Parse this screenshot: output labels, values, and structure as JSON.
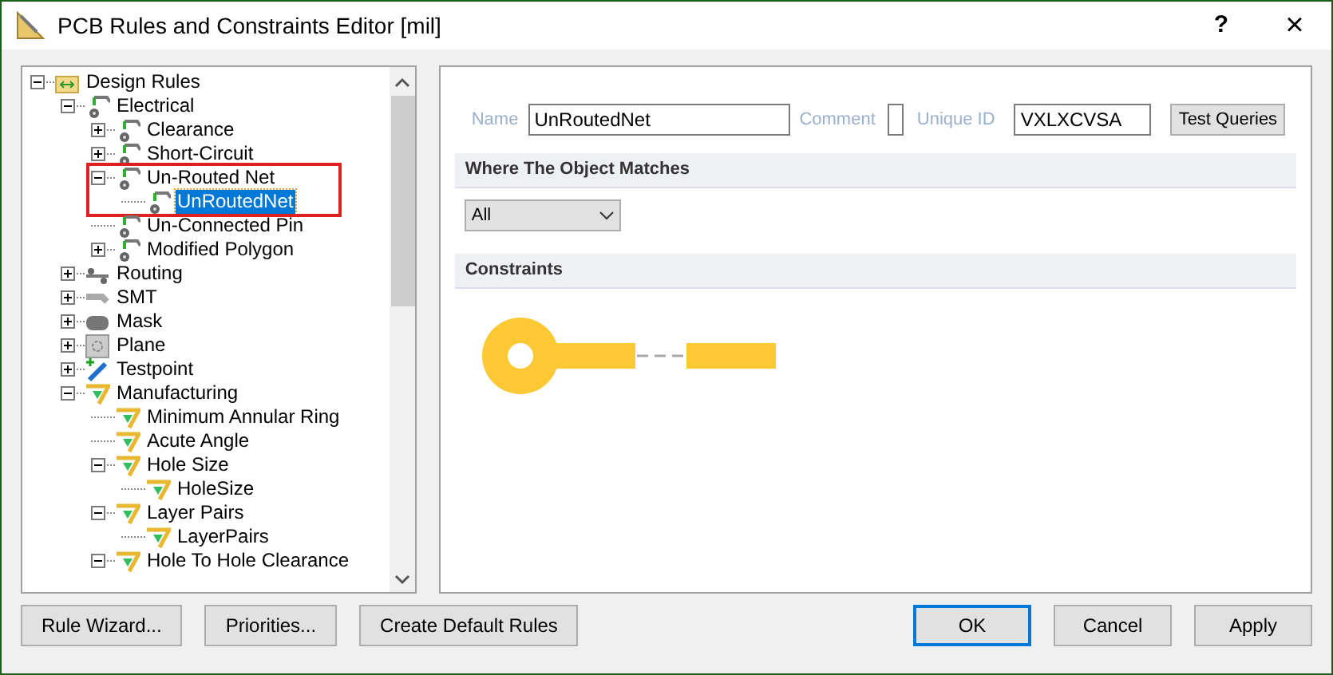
{
  "window": {
    "title": "PCB Rules and Constraints Editor [mil]",
    "help": "?",
    "close": "×"
  },
  "tree": [
    {
      "label": "Design Rules",
      "kind": "folder",
      "expanded": true,
      "selected": false,
      "children": [
        {
          "label": "Electrical",
          "kind": "electrical",
          "expanded": true,
          "selected": false,
          "children": [
            {
              "label": "Clearance",
              "kind": "electrical",
              "expanded": false,
              "selected": false
            },
            {
              "label": "Short-Circuit",
              "kind": "electrical",
              "expanded": false,
              "selected": false
            },
            {
              "label": "Un-Routed Net",
              "kind": "electrical",
              "expanded": true,
              "selected": false,
              "highlighted": true,
              "children": [
                {
                  "label": "UnRoutedNet",
                  "kind": "electrical",
                  "selected": true
                }
              ]
            },
            {
              "label": "Un-Connected Pin",
              "kind": "electrical",
              "selected": false
            },
            {
              "label": "Modified Polygon",
              "kind": "electrical",
              "expanded": false,
              "selected": false
            }
          ]
        },
        {
          "label": "Routing",
          "kind": "routing",
          "expanded": false,
          "selected": false
        },
        {
          "label": "SMT",
          "kind": "smt",
          "expanded": false,
          "selected": false
        },
        {
          "label": "Mask",
          "kind": "mask",
          "expanded": false,
          "selected": false
        },
        {
          "label": "Plane",
          "kind": "plane",
          "expanded": false,
          "selected": false
        },
        {
          "label": "Testpoint",
          "kind": "testpoint",
          "expanded": false,
          "selected": false
        },
        {
          "label": "Manufacturing",
          "kind": "manufacturing",
          "expanded": true,
          "selected": false,
          "children": [
            {
              "label": "Minimum Annular Ring",
              "kind": "manufacturing",
              "selected": false
            },
            {
              "label": "Acute Angle",
              "kind": "manufacturing",
              "selected": false
            },
            {
              "label": "Hole Size",
              "kind": "manufacturing",
              "expanded": true,
              "selected": false,
              "children": [
                {
                  "label": "HoleSize",
                  "kind": "manufacturing",
                  "selected": false
                }
              ]
            },
            {
              "label": "Layer Pairs",
              "kind": "manufacturing",
              "expanded": true,
              "selected": false,
              "children": [
                {
                  "label": "LayerPairs",
                  "kind": "manufacturing",
                  "selected": false
                }
              ]
            },
            {
              "label": "Hole To Hole Clearance",
              "kind": "manufacturing",
              "expanded": true,
              "selected": false
            }
          ]
        }
      ]
    }
  ],
  "rule": {
    "name_label": "Name",
    "name": "UnRoutedNet",
    "comment_label": "Comment",
    "unique_id_label": "Unique ID",
    "unique_id": "VXLXCVSA",
    "test_button": "Test Queries"
  },
  "where": {
    "title": "Where The Object Matches",
    "dropdown": "All"
  },
  "constraints": {
    "title": "Constraints"
  },
  "buttons_left": [
    "Rule Wizard...",
    "Priorities...",
    "Create Default Rules"
  ],
  "buttons_right": [
    {
      "label": "OK",
      "default": true
    },
    {
      "label": "Cancel",
      "default": false
    },
    {
      "label": "Apply",
      "default": false
    }
  ]
}
